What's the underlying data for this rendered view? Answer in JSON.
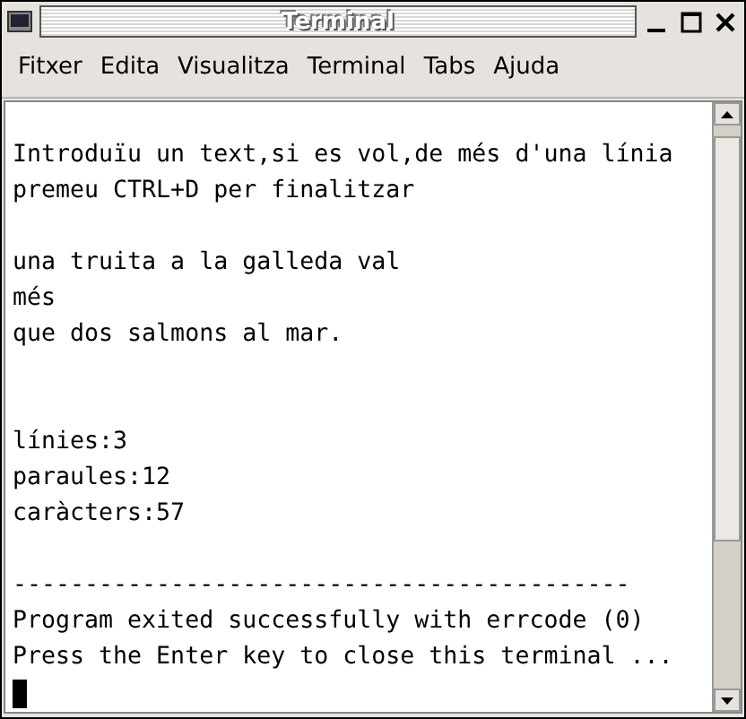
{
  "window": {
    "title": "Terminal"
  },
  "menu": [
    {
      "label": "Fitxer"
    },
    {
      "label": "Edita"
    },
    {
      "label": "Visualitza"
    },
    {
      "label": "Terminal"
    },
    {
      "label": "Tabs"
    },
    {
      "label": "Ajuda"
    }
  ],
  "terminal": {
    "lines": [
      {
        "kind": "blank"
      },
      {
        "kind": "text",
        "text": "Introduïu un text,si es vol,de més d'una línia"
      },
      {
        "kind": "text",
        "text": "premeu CTRL+D per finalitzar"
      },
      {
        "kind": "blank"
      },
      {
        "kind": "text",
        "text": "una truita a la galleda val"
      },
      {
        "kind": "text",
        "text": "més"
      },
      {
        "kind": "text",
        "text": "que dos salmons al mar."
      },
      {
        "kind": "blank"
      },
      {
        "kind": "blank"
      },
      {
        "kind": "text",
        "text": "línies:3"
      },
      {
        "kind": "text",
        "text": "paraules:12"
      },
      {
        "kind": "text",
        "text": "caràcters:57"
      },
      {
        "kind": "blank"
      },
      {
        "kind": "text",
        "text": "-------------------------------------------"
      },
      {
        "kind": "text",
        "text": "Program exited successfully with errcode (0)"
      },
      {
        "kind": "text",
        "text": "Press the Enter key to close this terminal ..."
      },
      {
        "kind": "cursor"
      }
    ]
  }
}
